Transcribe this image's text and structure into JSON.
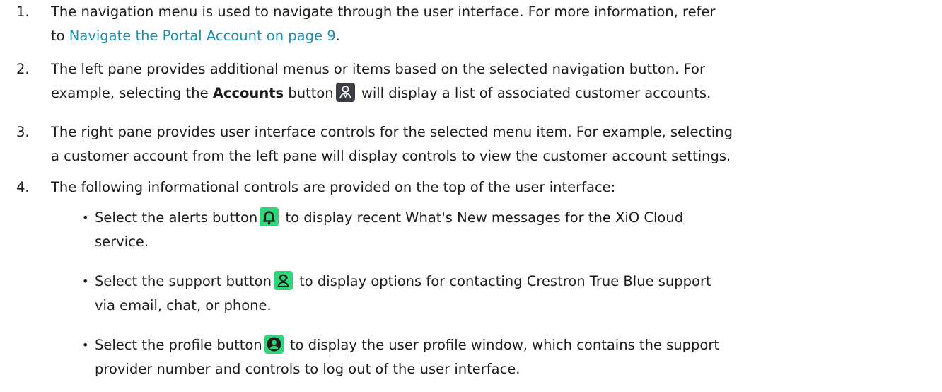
{
  "items": [
    {
      "number": "1.",
      "line1": "The navigation menu is used to navigate through the user interface. For more information, refer",
      "line2_prefix": "to ",
      "link": "Navigate the Portal Account on page 9",
      "line2_suffix": "."
    },
    {
      "number": "2.",
      "line1": "The left pane provides additional menus or items based on the selected navigation button. For",
      "line2_a": "example, selecting the ",
      "bold": "Accounts",
      "line2_b": " button",
      "line2_c": " will display a list of associated customer accounts."
    },
    {
      "number": "3.",
      "line1": "The right pane provides user interface controls for the selected menu item. For example, selecting",
      "line2": "a customer account from the left pane will display controls to view the customer account settings."
    },
    {
      "number": "4.",
      "line1": "The following informational controls are provided on the top of the user interface:"
    }
  ],
  "bullets": [
    {
      "a": "Select the alerts button",
      "b": " to display recent What's New messages for the XiO Cloud",
      "line2": "service."
    },
    {
      "a": "Select the support button",
      "b": " to display options for contacting Crestron True Blue support",
      "line2": "via email, chat, or phone."
    },
    {
      "a": "Select the profile button",
      "b": " to display the user profile window, which contains the support",
      "line2": "provider number and controls to log out of the user interface."
    }
  ],
  "icons": {
    "accounts": "accounts-icon",
    "alerts": "bell-icon",
    "support": "support-agent-icon",
    "profile": "profile-icon"
  },
  "colors": {
    "link": "#1a8fb8",
    "icon_dark": "#3b3f45",
    "icon_green": "#2ed67a"
  }
}
